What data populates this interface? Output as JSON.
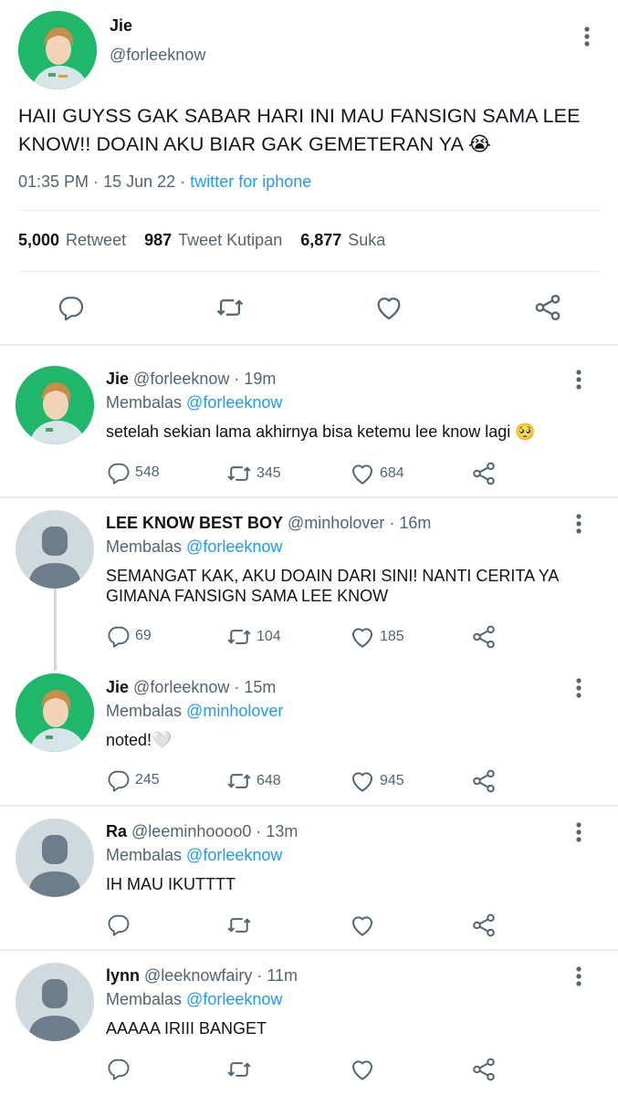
{
  "main": {
    "name": "Jie",
    "handle": "@forleeknow",
    "text": "HAII GUYSS GAK SABAR HARI INI MAU FANSIGN SAMA LEE KNOW!! DOAIN AKU BIAR GAK GEMETERAN YA 😭",
    "time": "01:35 PM",
    "date": "15 Jun 22",
    "dot": "·",
    "source": "twitter for iphone",
    "retweets": "5,000",
    "retweets_label": "Retweet",
    "quotes": "987",
    "quotes_label": "Tweet Kutipan",
    "likes": "6,877",
    "likes_label": "Suka"
  },
  "replies": [
    {
      "name": "Jie",
      "handle": "@forleeknow · 19m",
      "replying_label": "Membalas",
      "replying_to": "@forleeknow",
      "text": "setelah sekian lama akhirnya bisa ketemu lee know lagi 🥺",
      "replies": "548",
      "retweets": "345",
      "likes": "684"
    },
    {
      "name": "LEE KNOW BEST BOY",
      "handle": "@minholover · 16m",
      "replying_label": "Membalas",
      "replying_to": "@forleeknow",
      "text": "SEMANGAT KAK, AKU DOAIN DARI SINI! NANTI CERITA YA GIMANA FANSIGN SAMA LEE KNOW",
      "replies": "69",
      "retweets": "104",
      "likes": "185"
    },
    {
      "name": "Jie",
      "handle": "@forleeknow · 15m",
      "replying_label": "Membalas",
      "replying_to": "@minholover",
      "text": "noted!🤍",
      "replies": "245",
      "retweets": "648",
      "likes": "945"
    },
    {
      "name": "Ra",
      "handle": "@leeminhoooo0 · 13m",
      "replying_label": "Membalas",
      "replying_to": "@forleeknow",
      "text": "IH MAU IKUTTTT",
      "replies": "",
      "retweets": "",
      "likes": ""
    },
    {
      "name": "lynn",
      "handle": "@leeknowfairy · 11m",
      "replying_label": "Membalas",
      "replying_to": "@forleeknow",
      "text": "AAAAA IRIII BANGET",
      "replies": "",
      "retweets": "",
      "likes": ""
    }
  ],
  "colors": {
    "accent": "#1d9bf0",
    "secondary_text": "#536471",
    "photo_avatar_bg": "#1fb86a",
    "default_avatar_bg": "#cfd9de"
  },
  "icons": [
    "reply-icon",
    "retweet-icon",
    "like-icon",
    "share-icon",
    "more-icon",
    "avatar-photo",
    "default-avatar"
  ]
}
